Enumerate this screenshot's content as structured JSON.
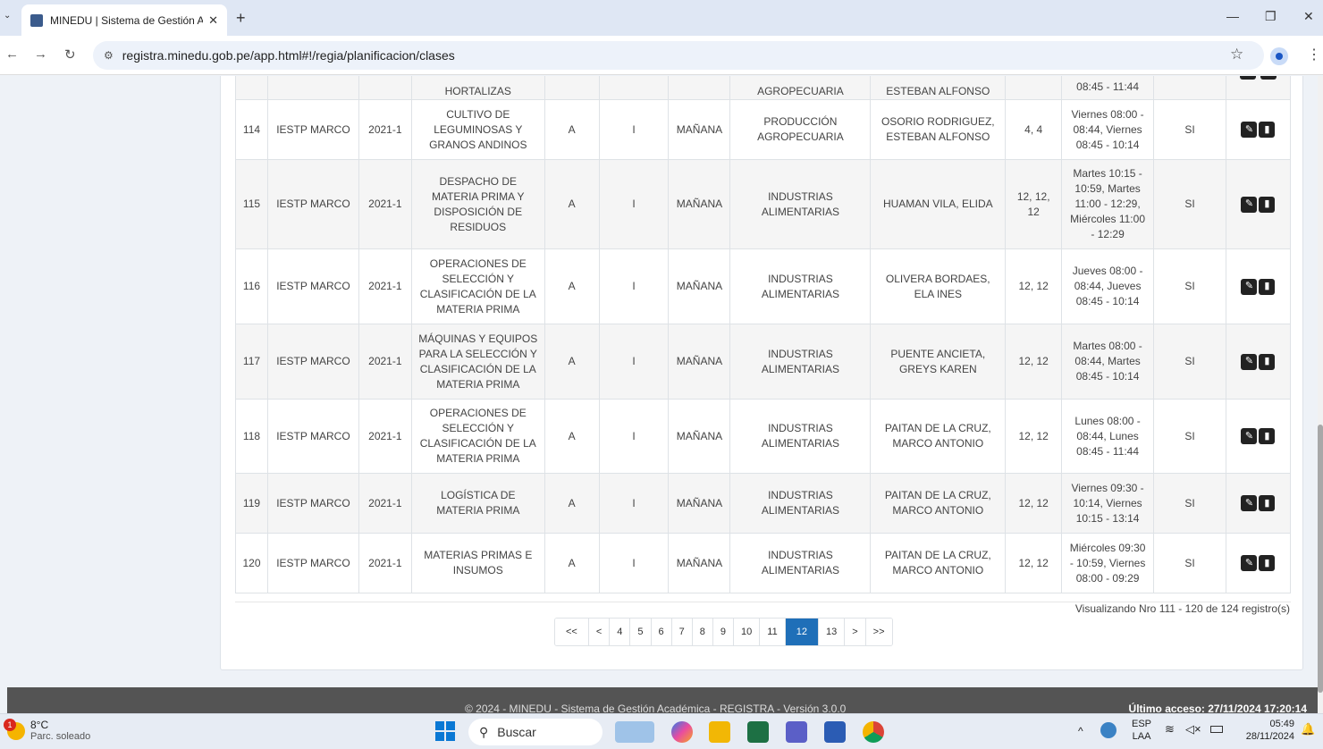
{
  "browser": {
    "tab_title": "MINEDU | Sistema de Gestión A",
    "tab_close": "✕",
    "new_tab": "+",
    "url": "registra.minedu.gob.pe/app.html#!/regia/planificacion/clases"
  },
  "table": {
    "partial_row": {
      "curso": "HORTALIZAS",
      "programa": "AGROPECUARIA",
      "docente": "ESTEBAN ALFONSO",
      "horario": "08:45 - 11:44"
    },
    "rows": [
      {
        "nro": "114",
        "institucion": "IESTP MARCO",
        "periodo": "2021-1",
        "curso": "CULTIVO DE LEGUMINOSAS Y GRANOS ANDINOS",
        "seccion": "A",
        "ciclo": "I",
        "turno": "MAÑANA",
        "programa": "PRODUCCIÓN AGROPECUARIA",
        "docente": "OSORIO RODRIGUEZ, ESTEBAN ALFONSO",
        "aula": "4, 4",
        "horario": "Viernes 08:00 - 08:44, Viernes 08:45 - 10:14",
        "activo": "SI"
      },
      {
        "nro": "115",
        "institucion": "IESTP MARCO",
        "periodo": "2021-1",
        "curso": "DESPACHO DE MATERIA PRIMA Y DISPOSICIÓN DE RESIDUOS",
        "seccion": "A",
        "ciclo": "I",
        "turno": "MAÑANA",
        "programa": "INDUSTRIAS ALIMENTARIAS",
        "docente": "HUAMAN VILA, ELIDA",
        "aula": "12, 12, 12",
        "horario": "Martes 10:15 - 10:59, Martes 11:00 - 12:29, Miércoles 11:00 - 12:29",
        "activo": "SI"
      },
      {
        "nro": "116",
        "institucion": "IESTP MARCO",
        "periodo": "2021-1",
        "curso": "OPERACIONES DE SELECCIÓN Y CLASIFICACIÓN DE LA MATERIA PRIMA",
        "seccion": "A",
        "ciclo": "I",
        "turno": "MAÑANA",
        "programa": "INDUSTRIAS ALIMENTARIAS",
        "docente": "OLIVERA BORDAES, ELA INES",
        "aula": "12, 12",
        "horario": "Jueves 08:00 - 08:44, Jueves 08:45 - 10:14",
        "activo": "SI"
      },
      {
        "nro": "117",
        "institucion": "IESTP MARCO",
        "periodo": "2021-1",
        "curso": "MÁQUINAS Y EQUIPOS PARA LA SELECCIÓN Y CLASIFICACIÓN DE LA MATERIA PRIMA",
        "seccion": "A",
        "ciclo": "I",
        "turno": "MAÑANA",
        "programa": "INDUSTRIAS ALIMENTARIAS",
        "docente": "PUENTE ANCIETA, GREYS KAREN",
        "aula": "12, 12",
        "horario": "Martes 08:00 - 08:44, Martes 08:45 - 10:14",
        "activo": "SI"
      },
      {
        "nro": "118",
        "institucion": "IESTP MARCO",
        "periodo": "2021-1",
        "curso": "OPERACIONES DE SELECCIÓN Y CLASIFICACIÓN DE LA MATERIA PRIMA",
        "seccion": "A",
        "ciclo": "I",
        "turno": "MAÑANA",
        "programa": "INDUSTRIAS ALIMENTARIAS",
        "docente": "PAITAN DE LA CRUZ, MARCO ANTONIO",
        "aula": "12, 12",
        "horario": "Lunes 08:00 - 08:44, Lunes 08:45 - 11:44",
        "activo": "SI"
      },
      {
        "nro": "119",
        "institucion": "IESTP MARCO",
        "periodo": "2021-1",
        "curso": "LOGÍSTICA DE MATERIA PRIMA",
        "seccion": "A",
        "ciclo": "I",
        "turno": "MAÑANA",
        "programa": "INDUSTRIAS ALIMENTARIAS",
        "docente": "PAITAN DE LA CRUZ, MARCO ANTONIO",
        "aula": "12, 12",
        "horario": "Viernes 09:30 - 10:14, Viernes 10:15 - 13:14",
        "activo": "SI"
      },
      {
        "nro": "120",
        "institucion": "IESTP MARCO",
        "periodo": "2021-1",
        "curso": "MATERIAS PRIMAS E INSUMOS",
        "seccion": "A",
        "ciclo": "I",
        "turno": "MAÑANA",
        "programa": "INDUSTRIAS ALIMENTARIAS",
        "docente": "PAITAN DE LA CRUZ, MARCO ANTONIO",
        "aula": "12, 12",
        "horario": "Miércoles 09:30 - 10:59, Viernes 08:00 - 09:29",
        "activo": "SI"
      }
    ]
  },
  "pagination": {
    "pages": [
      "<<",
      "<",
      "4",
      "5",
      "6",
      "7",
      "8",
      "9",
      "10",
      "11",
      "12",
      "13",
      ">",
      ">>"
    ],
    "active": "12",
    "info": "Visualizando Nro 111 - 120 de 124 registro(s)"
  },
  "footer": {
    "copyright": "© 2024 - MINEDU - Sistema de Gestión Académica - REGISTRA - Versión 3.0.0",
    "last_access": "Último acceso: 27/11/2024 17:20:14"
  },
  "taskbar": {
    "weather_temp": "8°C",
    "weather_cond": "Parc. soleado",
    "weather_badge": "1",
    "search_placeholder": "Buscar",
    "lang_top": "ESP",
    "lang_bottom": "LAA",
    "time": "05:49",
    "date": "28/11/2024"
  },
  "colors": {
    "pager_active": "#1f6fb8",
    "footer_bg": "#545454",
    "action_button": "#222222"
  }
}
